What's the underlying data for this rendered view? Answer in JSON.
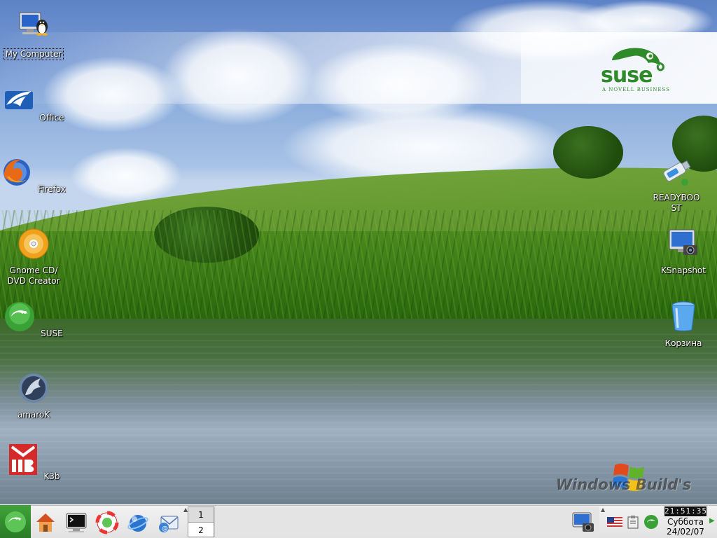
{
  "desktop": {
    "left_icons": [
      {
        "label": "My Computer",
        "icon": "my-computer-icon"
      },
      {
        "label": "Office",
        "icon": "office-icon"
      },
      {
        "label": "Firefox",
        "icon": "firefox-icon"
      },
      {
        "label": "Gnome CD/\nDVD Creator",
        "icon": "cd-dvd-creator-icon"
      },
      {
        "label": "SUSE",
        "icon": "suse-icon"
      },
      {
        "label": "amaroK",
        "icon": "amarok-icon"
      },
      {
        "label": "K3b",
        "icon": "k3b-icon"
      }
    ],
    "right_icons": [
      {
        "label": "READYBOO\nST",
        "icon": "usb-drive-icon"
      },
      {
        "label": "KSnapshot",
        "icon": "ksnapshot-icon"
      },
      {
        "label": "Корзина",
        "icon": "trash-icon"
      }
    ],
    "branding": {
      "logo_word": "suse",
      "logo_tagline": "A NOVELL BUSINESS",
      "watermark": "Windows Build's"
    }
  },
  "taskbar": {
    "quick_launch": [
      {
        "name": "home-icon"
      },
      {
        "name": "terminal-icon"
      },
      {
        "name": "help-icon"
      },
      {
        "name": "konqueror-icon"
      },
      {
        "name": "kontact-icon"
      }
    ],
    "pager": {
      "desktops": [
        "1",
        "2"
      ],
      "active_desktop": "1"
    },
    "clock": {
      "time": "21:51:35",
      "day": "Суббота",
      "date": "24/02/07"
    }
  },
  "colors": {
    "suse_green": "#2f8a2a",
    "taskbar_bg": "#e8e8e8"
  }
}
